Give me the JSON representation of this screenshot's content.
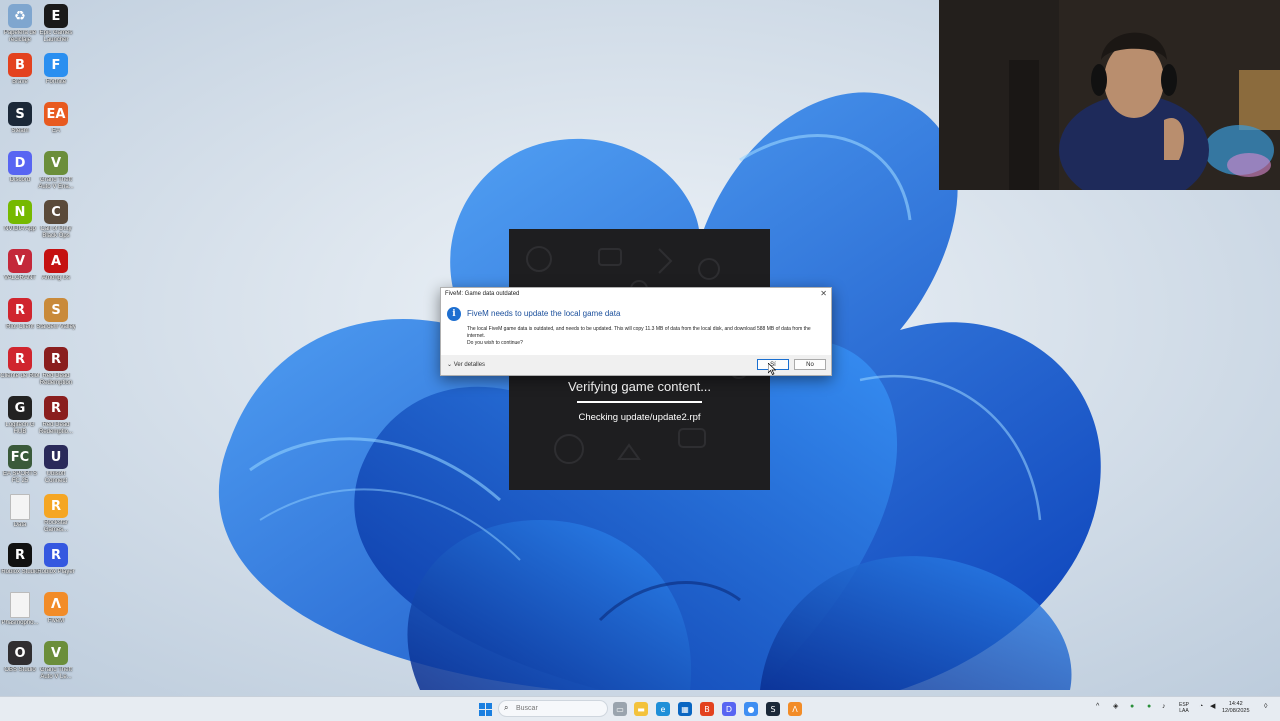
{
  "desktop": {
    "icons": [
      {
        "label": "Papelera de reciclaje",
        "icon": "recycle-bin-icon",
        "color": "#7fa6cf",
        "glyph": "♻"
      },
      {
        "label": "Epic Games Launcher",
        "icon": "epic-games-icon",
        "color": "#1a1a1a",
        "glyph": "E"
      },
      {
        "label": "Brave",
        "icon": "brave-icon",
        "color": "#e3421f",
        "glyph": "B"
      },
      {
        "label": "Fortnite",
        "icon": "fortnite-icon",
        "color": "#2a8ff0",
        "glyph": "F"
      },
      {
        "label": "Steam",
        "icon": "steam-icon",
        "color": "#1b2838",
        "glyph": "S"
      },
      {
        "label": "EA",
        "icon": "ea-icon",
        "color": "#e85a1f",
        "glyph": "EA"
      },
      {
        "label": "Discord",
        "icon": "discord-icon",
        "color": "#5865f2",
        "glyph": "D"
      },
      {
        "label": "Grand Theft Auto V Ena...",
        "icon": "gta-v-icon",
        "color": "#6b8e3a",
        "glyph": "V"
      },
      {
        "label": "NVIDIA App",
        "icon": "nvidia-icon",
        "color": "#76b900",
        "glyph": "N"
      },
      {
        "label": "Call of Duty Black Ops",
        "icon": "call-of-duty-icon",
        "color": "#5a4a3a",
        "glyph": "C"
      },
      {
        "label": "VALORANT",
        "icon": "valorant-icon",
        "color": "#c4283a",
        "glyph": "V"
      },
      {
        "label": "Among Us",
        "icon": "among-us-icon",
        "color": "#c51111",
        "glyph": "A"
      },
      {
        "label": "Riot Client",
        "icon": "riot-client-icon",
        "color": "#d0252e",
        "glyph": "R"
      },
      {
        "label": "Stardew Valley",
        "icon": "stardew-valley-icon",
        "color": "#c98a3a",
        "glyph": "S"
      },
      {
        "label": "Cliente de Riot",
        "icon": "riot-client-icon",
        "color": "#d0252e",
        "glyph": "R"
      },
      {
        "label": "Red Dead Redemption",
        "icon": "red-dead-icon",
        "color": "#8a1e1e",
        "glyph": "R"
      },
      {
        "label": "Logitech G HUB",
        "icon": "logitech-icon",
        "color": "#222222",
        "glyph": "G"
      },
      {
        "label": "Red Dead Redemptio...",
        "icon": "red-dead-icon",
        "color": "#8a1e1e",
        "glyph": "R"
      },
      {
        "label": "EA SPORTS FC 25",
        "icon": "ea-sports-fc-icon",
        "color": "#3a5a3a",
        "glyph": "FC"
      },
      {
        "label": "Ubisoft Connect",
        "icon": "ubisoft-icon",
        "color": "#2a2a5a",
        "glyph": "U"
      },
      {
        "label": "Data",
        "icon": "file-icon",
        "color": "#f4f4f4",
        "glyph": ""
      },
      {
        "label": "Rockstar Games...",
        "icon": "rockstar-icon",
        "color": "#f5a623",
        "glyph": "R"
      },
      {
        "label": "Roblox Studio",
        "icon": "roblox-studio-icon",
        "color": "#111111",
        "glyph": "R"
      },
      {
        "label": "Roblox Player",
        "icon": "roblox-player-icon",
        "color": "#3558e0",
        "glyph": "R"
      },
      {
        "label": "Phasmopho...",
        "icon": "file-icon",
        "color": "#f4f4f4",
        "glyph": ""
      },
      {
        "label": "FiveM",
        "icon": "fivem-icon",
        "color": "#f28c28",
        "glyph": "Λ"
      },
      {
        "label": "OBS Studio",
        "icon": "obs-icon",
        "color": "#302e31",
        "glyph": "O"
      },
      {
        "label": "Grand Theft Auto V Le...",
        "icon": "gta-v-icon",
        "color": "#6b8e3a",
        "glyph": "V"
      }
    ]
  },
  "fivem_loader": {
    "status": "Verifying game content...",
    "detail": "Checking update/update2.rpf",
    "progress": 1.0
  },
  "dialog": {
    "title": "FiveM: Game data outdated",
    "heading": "FiveM needs to update the local game data",
    "body": "The local FiveM game data is outdated, and needs to be updated. This will copy 11.3 MB of data from the local disk, and download 588 MB of data from the internet.",
    "question": "Do you wish to continue?",
    "details_label": "Ver detalles",
    "yes_label": "Sí",
    "no_label": "No"
  },
  "taskbar": {
    "search_placeholder": "Buscar",
    "apps": [
      {
        "icon": "file-explorer-icon",
        "color": "#f3c23c",
        "glyph": "▬"
      },
      {
        "icon": "edge-icon",
        "color": "#1f8fd8",
        "glyph": "e"
      },
      {
        "icon": "store-icon",
        "color": "#0a66c2",
        "glyph": "▦"
      },
      {
        "icon": "brave-icon",
        "color": "#e3421f",
        "glyph": "B"
      },
      {
        "icon": "discord-icon",
        "color": "#5865f2",
        "glyph": "D"
      },
      {
        "icon": "chrome-icon",
        "color": "#3f8ef2",
        "glyph": "●"
      },
      {
        "icon": "steam-icon",
        "color": "#1b2838",
        "glyph": "S"
      },
      {
        "icon": "fivem-icon",
        "color": "#f28c28",
        "glyph": "Λ"
      }
    ],
    "language": "ESP",
    "layout": "LAA",
    "time": "14:42",
    "date": "12/08/2025"
  }
}
